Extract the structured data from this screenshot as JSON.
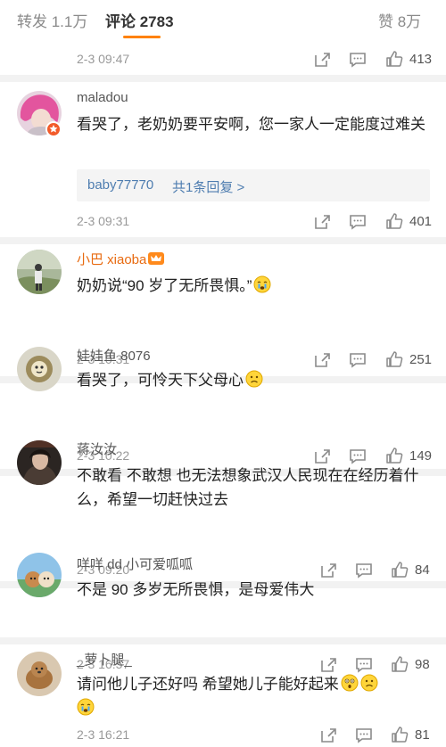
{
  "tabs": {
    "repost": "转发 1.1万",
    "comment": "评论 2783",
    "like": "赞 8万"
  },
  "top_meta": {
    "time": "2-3 09:47",
    "likes": "413"
  },
  "comments": [
    {
      "user": "maladou",
      "text": "看哭了，老奶奶要平安啊，您一家人一定能度过难关",
      "reply_user": "baby77770",
      "reply_count": "共1条回复 >",
      "time": "2-3 09:31",
      "likes": "401"
    },
    {
      "user": "小巴 xiaoba",
      "text": "奶奶说“90 岁了无所畏惧。”",
      "time": "2-3 10:31",
      "likes": "251"
    },
    {
      "user": "娃娃鱼 8076",
      "text": "看哭了，可怜天下父母心",
      "time": "2-3 10:22",
      "likes": "149"
    },
    {
      "user": "蒋汝汝",
      "text": "不敢看 不敢想 也无法想象武汉人民现在在经历着什么，希望一切赶快过去",
      "time": "2-3 09:20",
      "likes": "84"
    },
    {
      "user": "咩咩 dd 小可爱呱呱",
      "text": "不是 90 多岁无所畏惧，是母爱伟大",
      "time": "2-3 16:57",
      "likes": "98"
    },
    {
      "user": "_萝卜腿_",
      "text": "请问他儿子还好吗 希望她儿子能好起来",
      "time": "2-3 16:21",
      "likes": "81"
    }
  ],
  "colors": {
    "accent": "#ff8200",
    "link": "#4e7db0",
    "vip_name": "#e86a10",
    "meta": "#999999"
  },
  "icons": [
    "repost-icon",
    "comment-icon",
    "like-icon",
    "verified-badge-icon",
    "vip-crown-icon",
    "crying-emoji-icon",
    "sad-emoji-icon",
    "shocked-emoji-icon"
  ]
}
